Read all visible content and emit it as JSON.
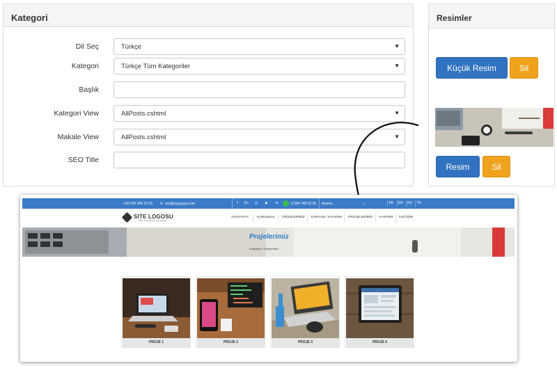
{
  "kategori": {
    "title": "Kategori",
    "fields": [
      {
        "label": "Dil Seç",
        "value": "Türkçe",
        "type": "select"
      },
      {
        "label": "Kategori",
        "value": "Türkçe Tüm Kategoriler",
        "type": "select"
      },
      {
        "label": "Başlık",
        "value": "",
        "type": "text"
      },
      {
        "label": "Kategori View",
        "value": "AllPosts.cshtml",
        "type": "select"
      },
      {
        "label": "Makale View",
        "value": "AllPosts.cshtml",
        "type": "select"
      },
      {
        "label": "SEO Title",
        "value": "",
        "type": "text"
      }
    ],
    "caret": "▼"
  },
  "resimler": {
    "title": "Resimler",
    "small_image_button": "Küçük Resim",
    "delete_button_1": "Sil",
    "image_button": "Resim",
    "delete_button_2": "Sil"
  },
  "colors": {
    "primary_blue": "#3173c0",
    "warning_orange": "#efa21c",
    "site_topbar": "#3a7bc8",
    "site_title_blue": "#2f7fc7"
  },
  "preview_site": {
    "topbar": {
      "phone": "+90 242 344 10 20",
      "email": "xxx@yyyyyyyy.com",
      "social_icons": [
        "f",
        "G+",
        "◎",
        "▶",
        "in"
      ],
      "whatsapp_phone": "0 544 748 10 20",
      "search_placeholder": "Arama...",
      "languages": [
        "FA",
        "EN",
        "RU",
        "TR"
      ]
    },
    "logo_title": "SITE LOGOSU",
    "logo_subtitle": "Site url.png.xyz xxx group",
    "nav": [
      "ANASAYFA",
      "KURUMSAL",
      "ÜRÜNLERİMİZ",
      "KARAYEL TASARIM",
      "PROJELERİMİZ",
      "KARYER",
      "İLETİŞİM"
    ],
    "banner_title": "Projelerimiz",
    "breadcrumb": "Anasayfa  »  Projelerimiz",
    "projects": [
      {
        "label": "PROJE 1"
      },
      {
        "label": "PROJE 2"
      },
      {
        "label": "PROJE 3"
      },
      {
        "label": "PROJE 4"
      }
    ]
  }
}
